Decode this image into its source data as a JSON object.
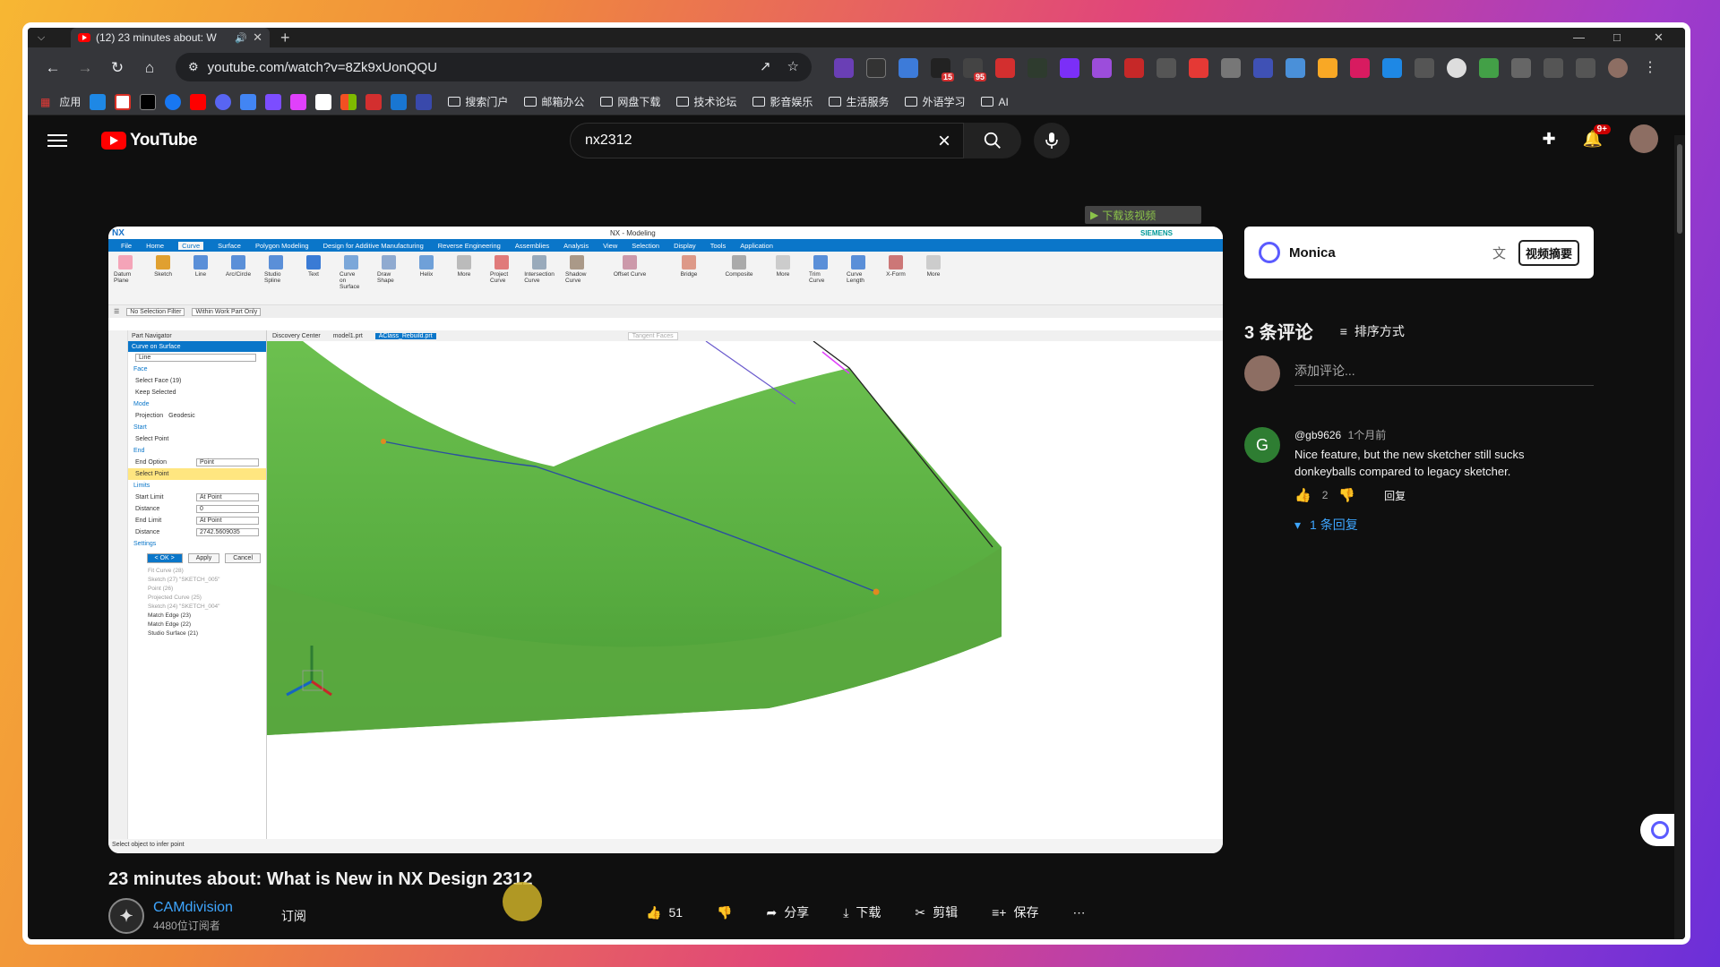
{
  "browser": {
    "tab_title": "(12) 23 minutes about: W",
    "url": "youtube.com/watch?v=8Zk9xUonQQU",
    "bookmarks_apps_label": "应用",
    "bookmark_folders": [
      "搜索门户",
      "邮箱办公",
      "网盘下载",
      "技术论坛",
      "影音娱乐",
      "生活服务",
      "外语学习",
      "AI"
    ],
    "ext_badges": [
      "15",
      "95"
    ]
  },
  "youtube": {
    "logo_text": "YouTube",
    "search_value": "nx2312",
    "notifications_badge": "9+"
  },
  "player": {
    "download_overlay": "下载该视频",
    "nx": {
      "title": "NX - Modeling",
      "brand": "SIEMENS",
      "menu": [
        "File",
        "Home",
        "Curve",
        "Surface",
        "Polygon Modeling",
        "Design for Additive Manufacturing",
        "Reverse Engineering",
        "Assemblies",
        "Analysis",
        "View",
        "Selection",
        "Display",
        "Tools",
        "Application"
      ],
      "ribbon": [
        "Datum Plane",
        "Sketch",
        "Line",
        "Arc/Circle",
        "Studio Spline",
        "Text",
        "Curve on Surface",
        "Draw Shape",
        "Helix",
        "More",
        "Project Curve",
        "Intersection Curve",
        "Shadow Curve",
        "Offset Curve",
        "Bridge",
        "Composite",
        "More",
        "Trim Curve",
        "Curve Length",
        "X-Form",
        "More"
      ],
      "filter": "No Selection Filter",
      "scope": "Within Work Part Only",
      "part_navigator": "Part Navigator",
      "dialog_title": "Curve on Surface",
      "type_value": "Line",
      "face_section": "Face",
      "select_face": "Select Face (19)",
      "keep_selected": "Keep Selected",
      "mode_section": "Mode",
      "mode_projection": "Projection",
      "mode_geodesic": "Geodesic",
      "start_section": "Start",
      "select_point": "Select Point",
      "end_section": "End",
      "end_option_label": "End Option",
      "end_option_value": "Point",
      "select_point_end": "Select Point",
      "limits_section": "Limits",
      "start_limit_label": "Start Limit",
      "start_limit_value": "At Point",
      "distance_label": "Distance",
      "distance_value": "0",
      "end_limit_label": "End Limit",
      "end_limit_value": "At Point",
      "distance2_label": "Distance",
      "distance2_value": "2742.5609035",
      "settings_section": "Settings",
      "ok": "< OK >",
      "apply": "Apply",
      "cancel": "Cancel",
      "tree": [
        "Fit Curve (28)",
        "Sketch (27) \"SKETCH_005\"",
        "Point (26)",
        "Projected Curve (25)",
        "Sketch (24) \"SKETCH_004\"",
        "Match Edge (23)",
        "Match Edge (22)",
        "Studio Surface (21)"
      ],
      "tabs": [
        "Discovery Center",
        "model1.prt",
        "AClass_Rebuild.prt"
      ],
      "tangent_faces": "Tangent Faces",
      "status": "Select object to infer point",
      "surface_color": "#5fb543"
    }
  },
  "video": {
    "title": "23 minutes about: What is New in NX Design 2312",
    "channel": "CAMdivision",
    "subscribers": "4480位订阅者",
    "subscribe": "订阅",
    "likes": "51",
    "share": "分享",
    "download": "下载",
    "clip": "剪辑",
    "save": "保存"
  },
  "monica": {
    "name": "Monica",
    "summary_btn": "视频摘要"
  },
  "comments": {
    "count": "3 条评论",
    "sort": "排序方式",
    "add_placeholder": "添加评论...",
    "items": [
      {
        "avatar_letter": "G",
        "author": "@gb9626",
        "time": "1个月前",
        "text": "Nice feature, but the new sketcher still sucks donkeyballs compared to legacy sketcher.",
        "likes": "2",
        "reply": "回复",
        "replies": "1 条回复"
      }
    ]
  }
}
